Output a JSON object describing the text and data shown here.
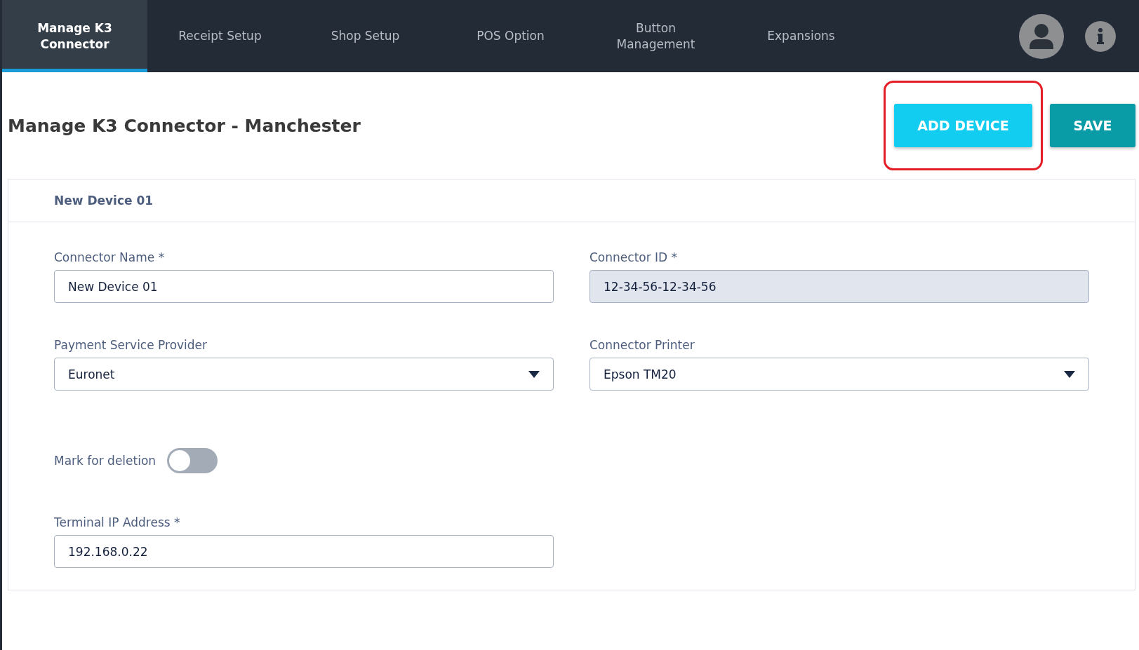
{
  "nav": {
    "tabs": [
      {
        "label": "Manage K3 Connector",
        "selected": true
      },
      {
        "label": "Receipt Setup",
        "selected": false
      },
      {
        "label": "Shop Setup",
        "selected": false
      },
      {
        "label": "POS Option",
        "selected": false
      },
      {
        "label": "Button Management",
        "selected": false
      },
      {
        "label": "Expansions",
        "selected": false
      }
    ]
  },
  "page": {
    "title": "Manage K3 Connector - Manchester",
    "buttons": [
      {
        "label": "ADD DEVICE",
        "kind": "add",
        "highlighted": true
      },
      {
        "label": "SAVE",
        "kind": "save",
        "highlighted": false
      }
    ]
  },
  "device": {
    "title": "New Device 01",
    "fields": [
      {
        "kind": "text",
        "label": "Connector Name *",
        "value": "New Device 01",
        "disabled": false
      },
      {
        "kind": "text",
        "label": "Connector ID *",
        "value": "12-34-56-12-34-56",
        "disabled": true
      },
      {
        "kind": "select",
        "label": "Payment Service Provider",
        "value": "Euronet",
        "disabled": false
      },
      {
        "kind": "select",
        "label": "Connector Printer",
        "value": "Epson TM20",
        "disabled": false
      },
      {
        "kind": "toggle",
        "label": "Mark for deletion",
        "on": false
      },
      {
        "kind": "text",
        "label": "Terminal IP Address *",
        "value": "192.168.0.22",
        "disabled": false
      }
    ]
  }
}
